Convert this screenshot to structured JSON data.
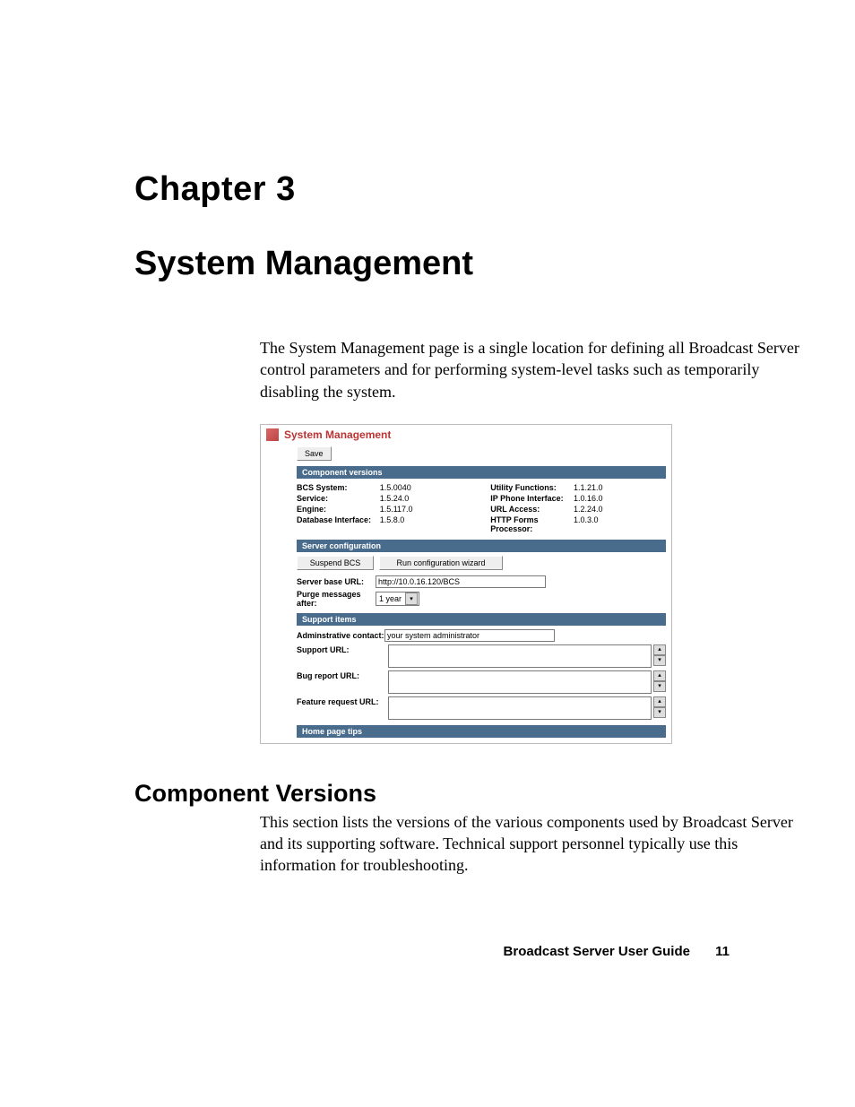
{
  "chapter_label": "Chapter  3",
  "chapter_title": "System Management",
  "intro_paragraph": "The System Management page is a single location for defining all Broadcast Server control parameters and for performing system-level tasks such as temporarily disabling the system.",
  "section2_heading": "Component Versions",
  "section2_paragraph": "This section lists the versions of the various components used by Broadcast Server and its supporting software. Technical support personnel typically use this information for troubleshooting.",
  "footer": {
    "title": "Broadcast Server User Guide",
    "page": "11"
  },
  "screenshot": {
    "title": "System Management",
    "save_label": "Save",
    "bars": {
      "component_versions": "Component versions",
      "server_configuration": "Server configuration",
      "support_items": "Support items",
      "home_page_tips": "Home page tips"
    },
    "versions_left": [
      {
        "k": "BCS System:",
        "v": "1.5.0040"
      },
      {
        "k": "Service:",
        "v": "1.5.24.0"
      },
      {
        "k": "Engine:",
        "v": "1.5.117.0"
      },
      {
        "k": "Database Interface:",
        "v": "1.5.8.0"
      }
    ],
    "versions_right": [
      {
        "k": "Utility Functions:",
        "v": "1.1.21.0"
      },
      {
        "k": "IP Phone Interface:",
        "v": "1.0.16.0"
      },
      {
        "k": "URL Access:",
        "v": "1.2.24.0"
      },
      {
        "k": "HTTP Forms Processor:",
        "v": "1.0.3.0"
      }
    ],
    "server_config": {
      "suspend_label": "Suspend BCS",
      "wizard_label": "Run configuration wizard",
      "base_url_label": "Server base URL:",
      "base_url_value": "http://10.0.16.120/BCS",
      "purge_label": "Purge messages after:",
      "purge_value": "1 year"
    },
    "support": {
      "admin_label": "Adminstrative contact:",
      "admin_value": "your system administrator",
      "support_url_label": "Support URL:",
      "bug_url_label": "Bug report URL:",
      "feature_url_label": "Feature request URL:"
    }
  }
}
